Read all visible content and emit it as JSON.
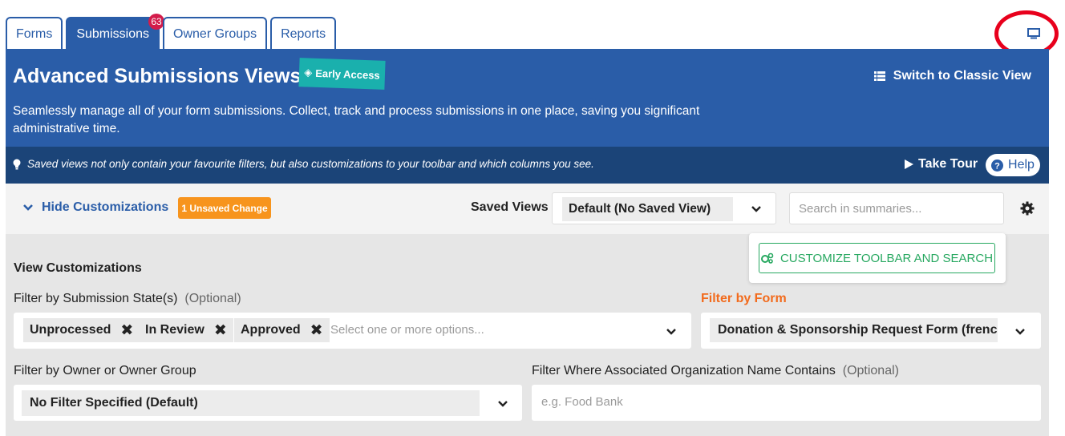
{
  "tabs": [
    {
      "label": "Forms"
    },
    {
      "label": "Submissions",
      "badge": "63"
    },
    {
      "label": "Owner Groups"
    },
    {
      "label": "Reports"
    }
  ],
  "header": {
    "title": "Advanced Submissions Views",
    "early_access": "Early Access",
    "switch_view": "Switch to Classic View",
    "description": "Seamlessly manage all of your form submissions. Collect, track and process submissions in one place, saving you significant administrative time."
  },
  "infobar": {
    "text": "Saved views not only contain your favourite filters, but also customizations to your toolbar and which columns you see.",
    "take_tour": "Take Tour",
    "help": "Help"
  },
  "toolbar": {
    "hide_customizations": "Hide Customizations",
    "unsaved": "1 Unsaved Change",
    "saved_views_label": "Saved Views",
    "saved_views_value": "Default (No Saved View)",
    "search_placeholder": "Search in summaries..."
  },
  "popover": {
    "button": "CUSTOMIZE TOOLBAR AND SEARCH"
  },
  "customizations": {
    "title": "View Customizations",
    "state_label": "Filter by Submission State(s)",
    "state_optional": "(Optional)",
    "state_chips": [
      "Unprocessed",
      "In Review",
      "Approved"
    ],
    "state_placeholder": "Select one or more options...",
    "form_label": "Filter by Form",
    "form_value": "Donation & Sponsorship Request Form (frenc...",
    "owner_label": "Filter by Owner or Owner Group",
    "owner_value": "No Filter Specified (Default)",
    "org_label": "Filter Where Associated Organization Name Contains",
    "org_optional": "(Optional)",
    "org_placeholder": "e.g. Food Bank"
  },
  "colors": {
    "primary": "#2a5da8",
    "dark": "#1b4478",
    "teal": "#1ab0ad",
    "orange": "#f7941d",
    "green": "#27a860",
    "badge": "#d31c4b",
    "annotation": "#e8001c"
  },
  "icons": [
    "monitor-icon",
    "tag-icon",
    "list-icon",
    "lightbulb-icon",
    "play-icon",
    "question-circle-icon",
    "chevron-down-icon",
    "gear-icon",
    "gears-icon",
    "close-icon"
  ]
}
